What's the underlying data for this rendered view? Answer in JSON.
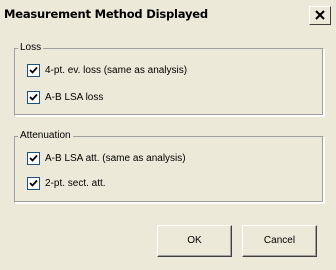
{
  "window": {
    "title": "Measurement Method Displayed",
    "close_icon": "close-icon"
  },
  "loss_group": {
    "legend": "Loss",
    "items": [
      {
        "label": "4-pt. ev. loss (same as analysis)",
        "checked": true
      },
      {
        "label": "A-B LSA loss",
        "checked": true
      }
    ]
  },
  "attenuation_group": {
    "legend": "Attenuation",
    "items": [
      {
        "label": "A-B LSA att. (same as analysis)",
        "checked": true
      },
      {
        "label": "2-pt. sect. att.",
        "checked": true
      }
    ]
  },
  "buttons": {
    "ok_label": "OK",
    "cancel_label": "Cancel"
  },
  "colors": {
    "background": "#ece9d8",
    "checkbox_border": "#1c5180",
    "checkmark": "#000000"
  }
}
